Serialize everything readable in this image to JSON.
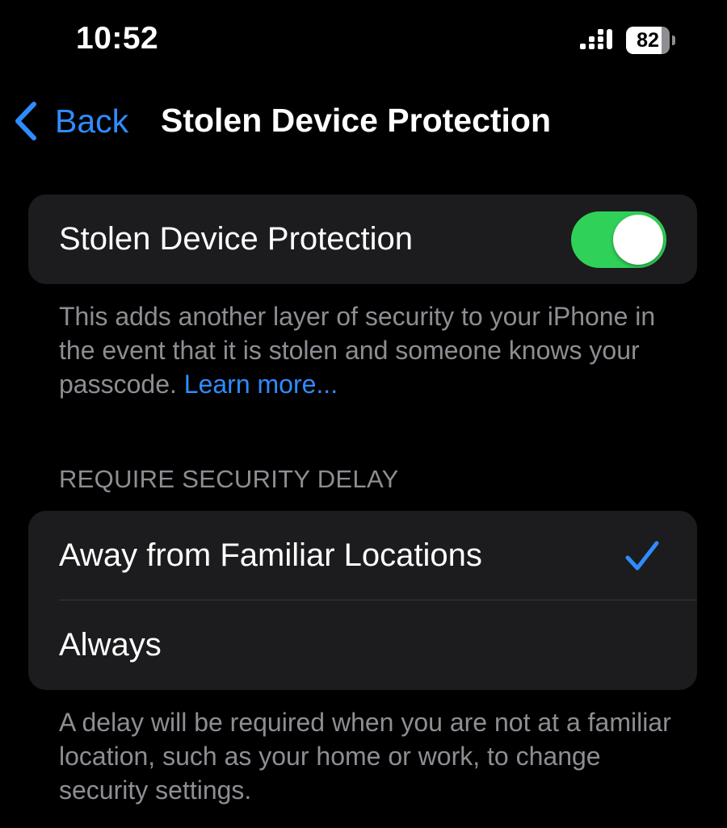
{
  "status_bar": {
    "time": "10:52",
    "battery_level": "82",
    "battery_fraction": 0.82,
    "signal_icon": "cellular-signal-icon"
  },
  "nav": {
    "back_label": "Back",
    "back_icon": "chevron-left-icon",
    "title": "Stolen Device Protection"
  },
  "protection": {
    "toggle_label": "Stolen Device Protection",
    "toggle_on": true,
    "description": "This adds another layer of security to your iPhone in the event that it is stolen and someone knows your passcode.",
    "learn_more": "Learn more..."
  },
  "security_delay": {
    "header": "REQUIRE SECURITY DELAY",
    "options": [
      {
        "label": "Away from Familiar Locations",
        "selected": true
      },
      {
        "label": "Always",
        "selected": false
      }
    ],
    "footer": "A delay will be required when you are not at a familiar location, such as your home or work, to change security settings."
  },
  "colors": {
    "background": "#000000",
    "group_background": "#1c1c1e",
    "accent_blue": "#2f8cff",
    "toggle_green": "#30d158",
    "secondary_text": "#8d8d93"
  }
}
